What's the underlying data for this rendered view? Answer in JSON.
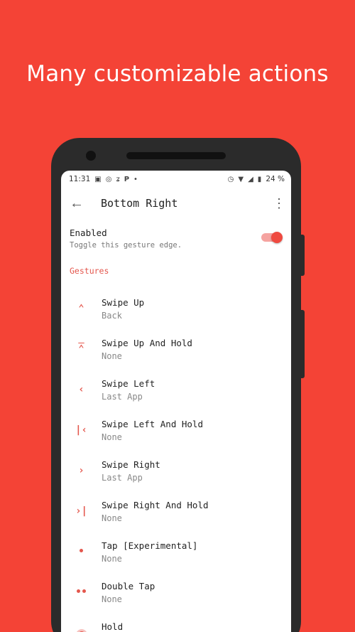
{
  "headline": "Many customizable actions",
  "status_bar": {
    "time": "11:31",
    "battery": "24 %"
  },
  "app_bar": {
    "title": "Bottom Right"
  },
  "enabled": {
    "title": "Enabled",
    "subtitle": "Toggle this gesture edge.",
    "on": true
  },
  "section": {
    "label": "Gestures"
  },
  "gestures": [
    {
      "name": "Swipe Up",
      "value": "Back",
      "icon": "chevron-up-icon"
    },
    {
      "name": "Swipe Up And Hold",
      "value": "None",
      "icon": "chevron-up-bar-icon"
    },
    {
      "name": "Swipe Left",
      "value": "Last App",
      "icon": "chevron-left-icon"
    },
    {
      "name": "Swipe Left And Hold",
      "value": "None",
      "icon": "chevron-left-bar-icon"
    },
    {
      "name": "Swipe Right",
      "value": "Last App",
      "icon": "chevron-right-icon"
    },
    {
      "name": "Swipe Right And Hold",
      "value": "None",
      "icon": "chevron-right-bar-icon"
    },
    {
      "name": "Tap [Experimental]",
      "value": "None",
      "icon": "single-dot-icon"
    },
    {
      "name": "Double Tap",
      "value": "None",
      "icon": "double-dot-icon"
    },
    {
      "name": "Hold",
      "value": "",
      "icon": "hold-dot-icon"
    }
  ],
  "colors": {
    "background": "#f44336",
    "accent": "#e4574d"
  }
}
